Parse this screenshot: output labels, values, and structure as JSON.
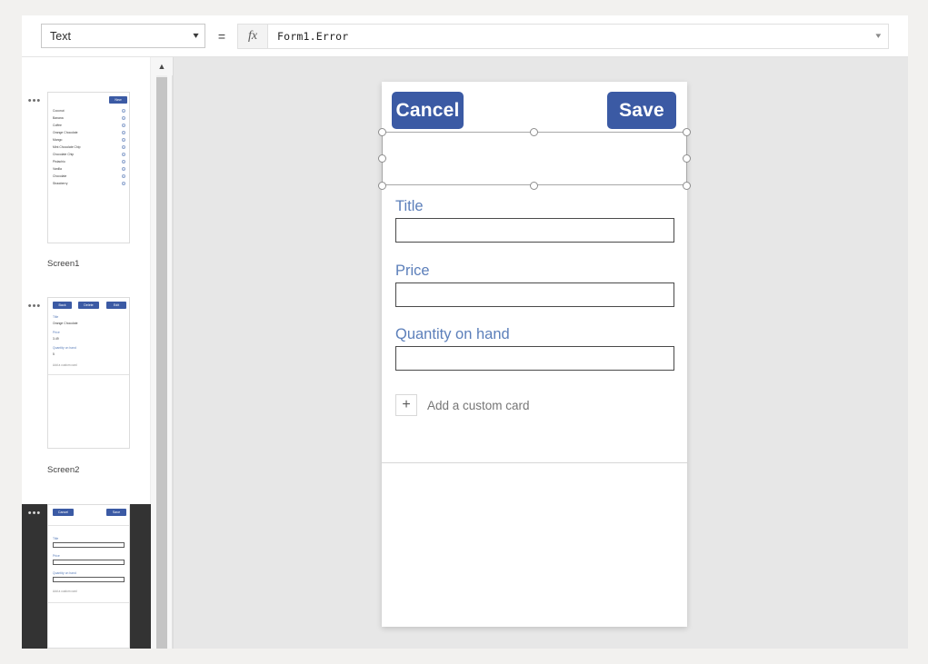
{
  "formula_bar": {
    "property_select": {
      "value": "Text",
      "chevron_icon": "chevron-down-icon"
    },
    "equals_sign": "=",
    "fx_icon": "fx",
    "formula_value": "Form1.Error",
    "formula_chevron_icon": "chevron-down-icon"
  },
  "screens_rail": {
    "ellipsis_icon": "ellipsis-icon",
    "scroll_up_icon": "chevron-up-icon",
    "items": [
      {
        "label": "Screen1",
        "selected": false,
        "type": "gallery",
        "new_button": "New",
        "list_items": [
          "Coconut",
          "Banana",
          "Coffee",
          "Orange Chocolate",
          "Mango",
          "Mint Chocolate Chip",
          "Chocolate Chip",
          "Pistachio",
          "Vanilla",
          "Chocolate",
          "Strawberry"
        ]
      },
      {
        "label": "Screen2",
        "selected": false,
        "type": "detail",
        "buttons": [
          "Back",
          "Delete",
          "Edit"
        ],
        "fields": [
          {
            "label": "Title",
            "value": "Orange Chocolate"
          },
          {
            "label": "Price",
            "value": "3.49"
          },
          {
            "label": "Quantity on hand",
            "value": "5"
          }
        ],
        "add_card": "Add a custom card"
      },
      {
        "label": "",
        "selected": true,
        "type": "edit",
        "buttons": [
          "Cancel",
          "Save"
        ],
        "fields": [
          {
            "label": "Title",
            "value": ""
          },
          {
            "label": "Price",
            "value": ""
          },
          {
            "label": "Quantity on hand",
            "value": ""
          }
        ],
        "add_card": "Add a custom card"
      }
    ]
  },
  "canvas": {
    "screen": {
      "cancel_button": "Cancel",
      "save_button": "Save",
      "selected_label": {
        "text": "",
        "handles": 8
      },
      "fields": [
        {
          "label": "Title",
          "value": ""
        },
        {
          "label": "Price",
          "value": ""
        },
        {
          "label": "Quantity on hand",
          "value": ""
        }
      ],
      "add_custom_card": {
        "plus_icon": "plus-icon",
        "text": "Add a custom card"
      }
    }
  },
  "colors": {
    "accent_blue": "#3b5aa4",
    "label_blue": "#5c7fba",
    "canvas_bg": "#e7e7e7",
    "selected_thumb_bg": "#333333"
  }
}
